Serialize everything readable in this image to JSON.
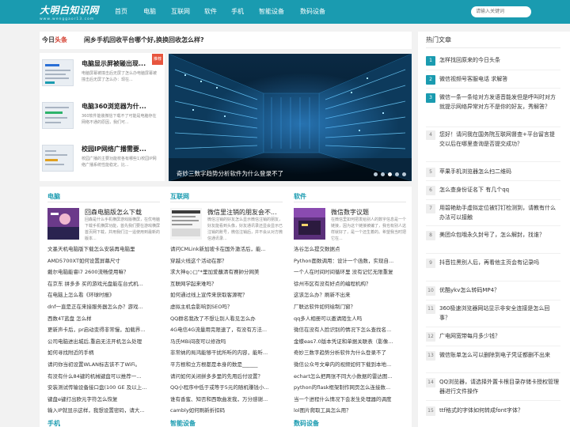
{
  "header": {
    "logo": "大明白知识网",
    "logo_sub": "www.wenggaor13.com",
    "nav": [
      "首页",
      "电脑",
      "互联网",
      "软件",
      "手机",
      "智能设备",
      "数码设备"
    ],
    "search_placeholder": "请输入关键词"
  },
  "headline": {
    "label_a": "今日",
    "label_b": "头条",
    "text": "闲乡手机回收平台哪个好,换换回收怎么样?"
  },
  "featured": {
    "ribbon": "推荐",
    "items": [
      {
        "title": "电脑显示屏被碰出现...",
        "desc": "电脑屏幕被撞击后无屏了怎么办电脑屏幕被撞击后无屏了怎么办：现在..."
      },
      {
        "title": "电脑360浏览器为什...",
        "desc": "360软件能装微信下载不了可能是电脑存在网络不通的原因，我们可..."
      },
      {
        "title": "校园IP网络广播需要...",
        "desc": "校园广播的主要功能校各有哪些1)校园IP网络广播系统性能稳定。比..."
      }
    ]
  },
  "slider": {
    "caption": "奇妙三数字趋势分析软件为什么登录不了"
  },
  "categories": [
    {
      "name": "电脑",
      "lead_title": "回森电脑版怎么下载",
      "lead_desc": "回森是什么手机横屏游戏版横屏，在优电脑下载手机横屏功能，首先我们要在游戏横屏首页网下载，并用我们注一遥使用到最新的版本...",
      "items": [
        "文墨天机电脑版下载怎么安装再电脑里",
        "AMD5700XT如何设置屏幕尺寸",
        "戴尔电脑能睿i7 2600流畅使用嘛？",
        "在京东 拼多多 买的游戏光盘能在台式机...",
        "在电脑上怎么看《环球时报》",
        "dnf一直是正在来接服务器怎么办？游戏...",
        "西数4T蓝盘 怎么样",
        "更新声卡后，pr启动变得非常慢，加载界...",
        "公司电脑进出城后,重启无法开机怎么处理",
        "如何寻找附近的手柄",
        "请问你当初设置WLAN标志该不了WiFi。",
        "有没有什么84键的机械键盘可以推荐一...",
        "安装测试传输设备接口盘(100 GE 及以上...",
        "键盘e键打出欧元字符怎么恢复",
        "输入IP就显示这样，我想设置密码，请大..."
      ]
    },
    {
      "name": "互联网",
      "lead_title": "微信里注销的朋友会不...",
      "lead_desc": "微信注销的好友怎么显示微信注销的朋友，好友能看到头像，好友通讯录还显会显示已注销的账号，微信注销后，并不会从对方微信通讯录...",
      "items": [
        "请问CMLink新加坡卡在国外激活后，能...",
        "穿越火线这个活动在那？",
        "求大神q◇□\"*里加爱蘸清有赛帥分网美",
        "互联网学起来难吗？",
        "如何通过线上宣传来获取客源呢？",
        "虚拟主机会影响到SEO吗？",
        "QQ群名我改了不想让别人看见怎么办",
        "4G电信4G流量用完限速了，有没有方法...",
        "马氏MBi间夜可以修改吗",
        "非常纳的局鸿能够干扰所听的内容，能听...",
        "平方根和立方根都是本身的数是______",
        "请问如何关闭拼多多里的先用后付设置？",
        "QQ小程序中低于或等于5元的随机赚钱小...",
        "谁有香蜜、知否和西歌曲发我，万分感谢...",
        "cambly如何刷新折扣码"
      ]
    },
    {
      "name": "软件",
      "lead_title": "微信数字议题",
      "lead_desc": "在微信里如何把发给别人的数字信息是一个链接，因为这个链接被编了，我也有别人这样就好了，是一个还生着的。希望我当时把它在...",
      "items": [
        "洛谷怎么提交数据点",
        "Python面数调用：设计一个函数，实现自...",
        "一个人在时间时间循环里 没有记忆无限重复",
        "徐州市区有没有好点的编程机构？",
        "这该怎么办？刷新不出来",
        "厂联达软件如何绘制门窗？",
        "qq多人相册可以邀请陌生人吗",
        "微信在没有人脸识别的情况下怎么查找名...",
        "金蝶eas7.0版本凭证和单据关联表（影像...",
        "奇妙三数字趋势分析软件为什么登录不了",
        "微信公众号文章内的视频如何下载到本地...",
        "echart怎么把两张不同大小数据的雷达图...",
        "python的flask框架制作网页怎么连接数...",
        "当一个进程什么情况下会发生处理器的调度",
        "lol图片爬取工具怎么用？"
      ]
    }
  ],
  "bottom_categories": [
    "手机",
    "智能设备",
    "数码设备"
  ],
  "sidebar": {
    "title": "热门文章",
    "items": [
      {
        "num": "1",
        "text": "怎样找回原来的今日头条"
      },
      {
        "num": "2",
        "text": "微信视频号客服电话 求解答"
      },
      {
        "num": "3",
        "text": "微信一条一条给对方发语音能发但是呼叫时对方就提示网络异常对方不是你的好友，秀解答？"
      },
      {
        "num": "4",
        "text": "您好！请问我在国务院互联网督查+平台留言提交以后在哪里查询是否提交成功？"
      },
      {
        "num": "5",
        "text": "苹果手机浏览器怎么扫二维码"
      },
      {
        "num": "6",
        "text": "怎么查身份证名下 有几个qq"
      },
      {
        "num": "7",
        "text": "用碧艳助手虚拟定位被钉钉检测到，请教有什么办法可以接触"
      },
      {
        "num": "8",
        "text": "美团众包哦永久封号了，怎么解封，找谁？"
      },
      {
        "num": "9",
        "text": "抖音拉黑别人后，再看他主页会有记录吗"
      },
      {
        "num": "10",
        "text": "优酷ykv怎么转码MP4？"
      },
      {
        "num": "11",
        "text": "360极速浏览器网站显示非安全连接是怎么回事？"
      },
      {
        "num": "12",
        "text": "广电网宽带每月多少钱？"
      },
      {
        "num": "13",
        "text": "微信账单怎么可以删除到电子凭证都删不出来"
      },
      {
        "num": "14",
        "text": "QQ浏览器，请选择外置卡根目录存储卡授权管理器进行文件操作"
      },
      {
        "num": "15",
        "text": "ttf格式的字体如何转成font字体？"
      }
    ]
  },
  "colors": {
    "brand": "#1a9bb0",
    "accent_red": "#d43f30"
  }
}
